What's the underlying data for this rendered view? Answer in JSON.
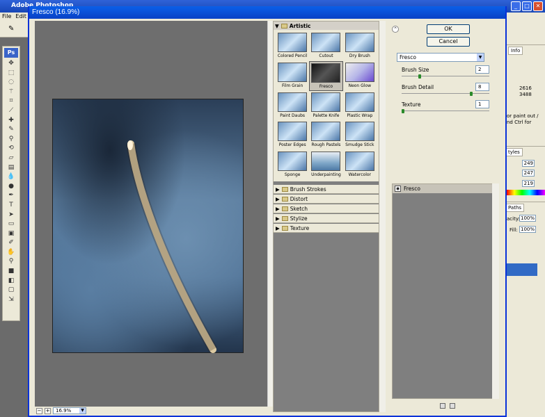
{
  "ps": {
    "title": "Adobe Photoshop",
    "menu": [
      "File",
      "Edit"
    ],
    "logo": "Ps"
  },
  "dialog": {
    "title": "Fresco (16.9%)",
    "zoom": "16.9%"
  },
  "gallery": {
    "group": "Artistic",
    "thumbs": [
      "Colored Pencil",
      "Cutout",
      "Dry Brush",
      "Film Grain",
      "Fresco",
      "Neon Glow",
      "Paint Daubs",
      "Palette Knife",
      "Plastic Wrap",
      "Poster Edges",
      "Rough Pastels",
      "Smudge Stick",
      "Sponge",
      "Underpainting",
      "Watercolor"
    ],
    "selected": "Fresco",
    "categories": [
      "Brush Strokes",
      "Distort",
      "Sketch",
      "Stylize",
      "Texture"
    ]
  },
  "buttons": {
    "ok": "OK",
    "cancel": "Cancel"
  },
  "settings": {
    "filter": "Fresco",
    "params": [
      {
        "label": "Brush Size",
        "value": "2",
        "level": 0.2
      },
      {
        "label": "Brush Detail",
        "value": "8",
        "level": 0.8
      },
      {
        "label": "Texture",
        "value": "1",
        "level": 0.0
      }
    ]
  },
  "layers": {
    "name": "Fresco"
  },
  "right_panel": {
    "info_tab": "Info",
    "info_vals": [
      "2616",
      "3488"
    ],
    "info_note": "or paint out / nd Ctrl for",
    "styles_tab": "tyles",
    "color_vals": [
      "249",
      "247",
      "219"
    ],
    "paths_tab": "Paths",
    "opacity_label": "acity:",
    "opacity": "100%",
    "fill_label": "Fill:",
    "fill": "100%"
  }
}
